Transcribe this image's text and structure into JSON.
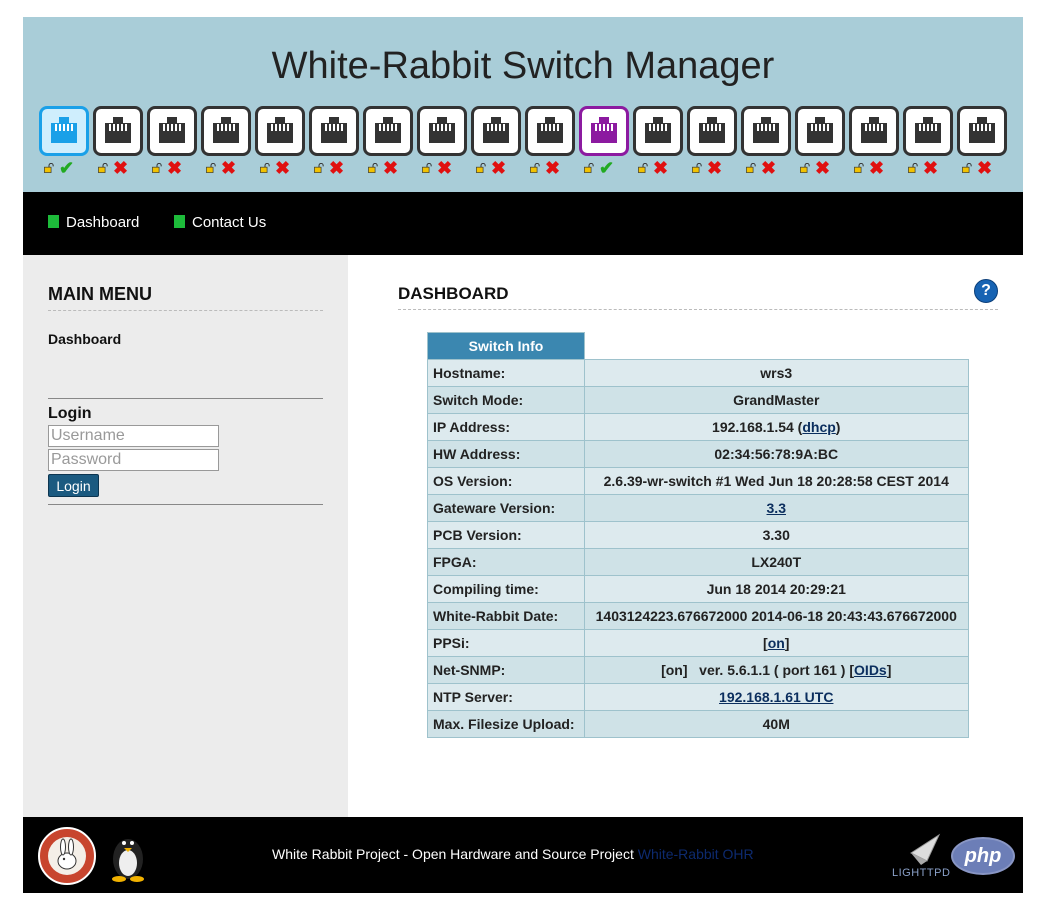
{
  "header": {
    "title": "White-Rabbit Switch Manager",
    "ports": [
      {
        "state": "up",
        "link": "ok"
      },
      {
        "state": "down",
        "link": "bad"
      },
      {
        "state": "down",
        "link": "bad"
      },
      {
        "state": "down",
        "link": "bad"
      },
      {
        "state": "down",
        "link": "bad"
      },
      {
        "state": "down",
        "link": "bad"
      },
      {
        "state": "down",
        "link": "bad"
      },
      {
        "state": "down",
        "link": "bad"
      },
      {
        "state": "down",
        "link": "bad"
      },
      {
        "state": "down",
        "link": "bad"
      },
      {
        "state": "grandmaster",
        "link": "ok"
      },
      {
        "state": "down",
        "link": "bad"
      },
      {
        "state": "down",
        "link": "bad"
      },
      {
        "state": "down",
        "link": "bad"
      },
      {
        "state": "down",
        "link": "bad"
      },
      {
        "state": "down",
        "link": "bad"
      },
      {
        "state": "down",
        "link": "bad"
      },
      {
        "state": "down",
        "link": "bad"
      }
    ]
  },
  "nav": {
    "items": [
      {
        "label": "Dashboard"
      },
      {
        "label": "Contact Us"
      }
    ]
  },
  "sidebar": {
    "title": "MAIN MENU",
    "link": "Dashboard",
    "login": {
      "label": "Login",
      "username_placeholder": "Username",
      "password_placeholder": "Password",
      "button": "Login"
    }
  },
  "main": {
    "title": "DASHBOARD",
    "help": "?",
    "table_header": "Switch Info",
    "rows": {
      "hostname": {
        "label": "Hostname:",
        "value": "wrs3"
      },
      "switch_mode": {
        "label": "Switch Mode:",
        "value": "GrandMaster"
      },
      "ip": {
        "label": "IP Address:",
        "value": "192.168.1.54",
        "link": "dhcp"
      },
      "hw": {
        "label": "HW Address:",
        "value": "02:34:56:78:9A:BC"
      },
      "os": {
        "label": "OS Version:",
        "value": "2.6.39-wr-switch #1 Wed Jun 18 20:28:58 CEST 2014"
      },
      "gateware": {
        "label": "Gateware Version:",
        "link": "3.3"
      },
      "pcb": {
        "label": "PCB Version:",
        "value": "3.30"
      },
      "fpga": {
        "label": "FPGA:",
        "value": "LX240T"
      },
      "compiling": {
        "label": "Compiling time:",
        "value": "Jun 18 2014 20:29:21"
      },
      "wr_date": {
        "label": "White-Rabbit Date:",
        "value": "1403124223.676672000 2014-06-18 20:43:43.676672000"
      },
      "ppsi": {
        "label": "PPSi:",
        "link": "on"
      },
      "snmp": {
        "label": "Net-SNMP:",
        "value": "[on]   ver. 5.6.1.1 ( port 161 )",
        "link": "OIDs"
      },
      "ntp": {
        "label": "NTP Server:",
        "link": "192.168.1.61 UTC"
      },
      "upload": {
        "label": "Max. Filesize Upload:",
        "value": "40M"
      }
    }
  },
  "footer": {
    "text": "White Rabbit Project - Open Hardware and Source Project",
    "link": "White-Rabbit OHR",
    "php_logo": "php"
  },
  "colors": {
    "header_bg": "#a9cdd8",
    "table_header": "#3b87b0",
    "port_up": "#1aa0e8",
    "port_grandmaster": "#8c1aa0",
    "status_ok": "#22aa22",
    "status_bad": "#e01010"
  }
}
